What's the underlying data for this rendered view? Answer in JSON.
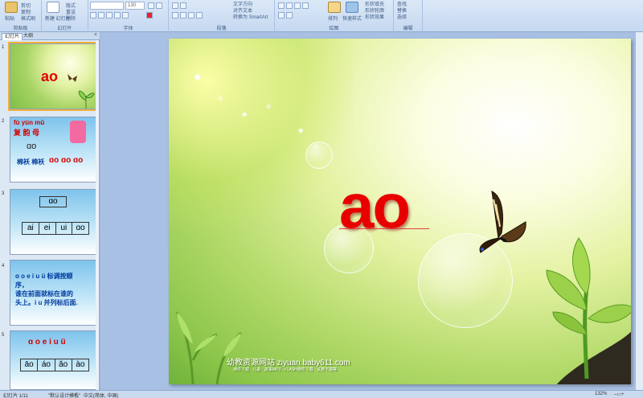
{
  "ribbon": {
    "clipboard": {
      "paste": "粘贴",
      "cut": "剪切",
      "copy": "复制",
      "format_painter": "格式刷",
      "label": "剪贴板"
    },
    "slides": {
      "new_slide": "新建\n幻灯片",
      "layout": "版式",
      "reset": "重设",
      "delete": "删除",
      "label": "幻灯片"
    },
    "font": {
      "size": "130",
      "label": "字体"
    },
    "paragraph": {
      "text_direction": "文字方向",
      "align_text": "对齐文本",
      "smartart": "转换为 SmartArt",
      "label": "段落"
    },
    "drawing": {
      "arrange": "排列",
      "quick_styles": "快速样式",
      "shape_fill": "形状填充",
      "shape_outline": "形状轮廓",
      "shape_effects": "形状效果",
      "label": "绘图"
    },
    "editing": {
      "find": "查找",
      "replace": "替换",
      "select": "选择",
      "label": "编辑"
    }
  },
  "left_panel": {
    "tabs": [
      "幻灯片",
      "大纲"
    ],
    "thumbs": [
      {
        "num": "1",
        "text": "ao"
      },
      {
        "num": "2",
        "pinyin": "fù yùn mǔ",
        "hanzi": "复 韵 母",
        "ao": "ɑo",
        "line": "棉袄 棉袄",
        "line_red": "ɑo ɑo ɑo"
      },
      {
        "num": "3",
        "ao": "ɑo",
        "cells": [
          "ai",
          "ei",
          "ui",
          "ɑo"
        ]
      },
      {
        "num": "4",
        "line1": "ɑ o e i u ü 标调按顺",
        "line2": "序，",
        "line3": "谁在前面就标在谁的",
        "line4": "头上。i u 并列标后面."
      },
      {
        "num": "5",
        "title": "ɑ o e i u ü",
        "cells": [
          "āo",
          "áo",
          "ǎo",
          "ào"
        ]
      }
    ]
  },
  "slide": {
    "title": "ao",
    "footer": "幼教资源网站  ziyuan.baby611.com",
    "footer_sub": "课件下载 · 儿歌 · 故事MP3 · FLASH课件下载 · 试卷下载等"
  },
  "status": {
    "slide_count": "幻灯片 1/11",
    "theme": "\"默认设计模板\"",
    "lang": "中文(简体, 中国)",
    "zoom": "132%"
  }
}
